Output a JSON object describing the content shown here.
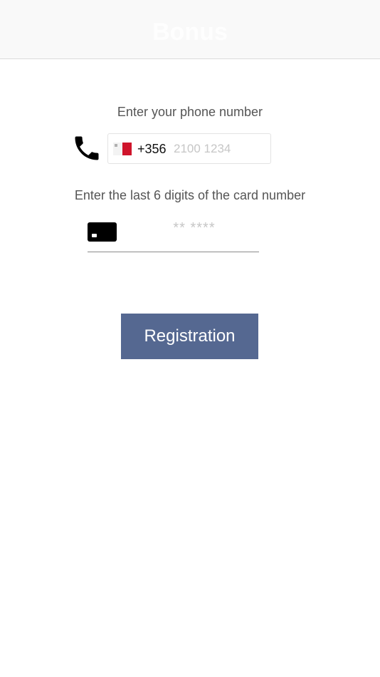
{
  "header": {
    "logo_text": "Bonus"
  },
  "phone": {
    "label": "Enter your phone number",
    "icon": "phone-icon",
    "country_flag": "malta-flag",
    "dial_code": "+356",
    "placeholder": "2100 1234",
    "value": ""
  },
  "card": {
    "label": "Enter the last 6 digits of the card number",
    "icon": "card-icon",
    "placeholder": "** ****",
    "value": ""
  },
  "actions": {
    "register_label": "Registration"
  },
  "colors": {
    "button": "#556891",
    "flag_red": "#cf142b"
  }
}
